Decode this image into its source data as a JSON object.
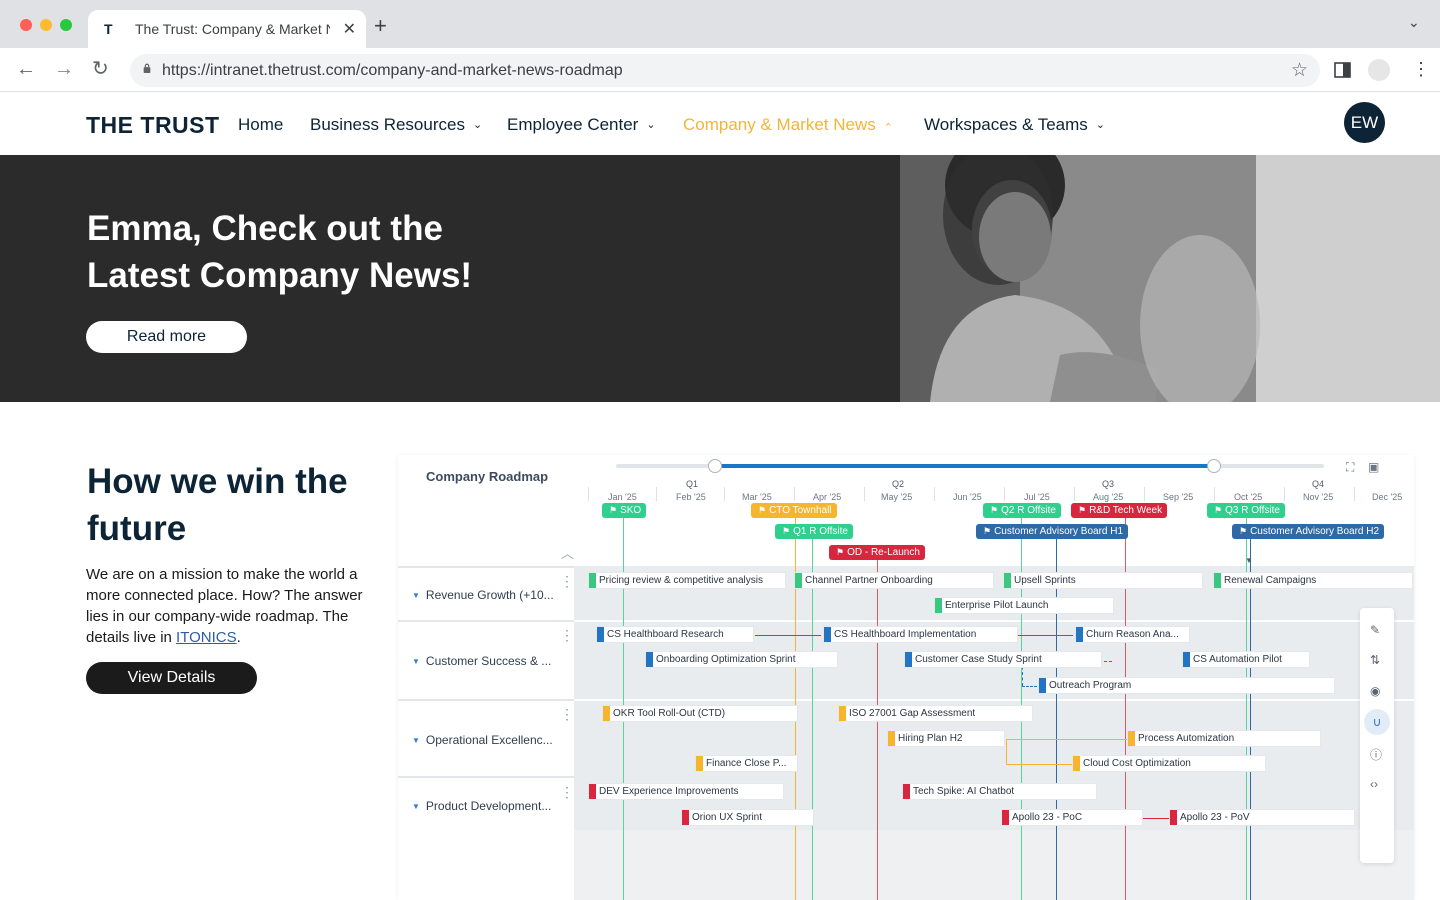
{
  "browser": {
    "tab_title": "The Trust: Company & Market News",
    "tab_favicon": "T",
    "url": "https://intranet.thetrust.com/company-and-market-news-roadmap",
    "icons": [
      "back-icon",
      "forward-icon",
      "reload-icon",
      "lock-icon",
      "star-icon",
      "sidepanel-icon",
      "profile-icon",
      "menu-icon"
    ]
  },
  "site": {
    "logo": "THE TRUST",
    "nav": [
      {
        "label": "Home",
        "active": false
      },
      {
        "label": "Business Resources",
        "active": false
      },
      {
        "label": "Employee Center",
        "active": false
      },
      {
        "label": "Company & Market News",
        "active": true
      },
      {
        "label": "Workspaces & Teams",
        "active": false
      }
    ],
    "avatar_initials": "EW",
    "accent_color": "#f2b635",
    "navy": "#0d2436"
  },
  "hero": {
    "headline": "Emma, Check out the Latest Company News!",
    "button": "Read more"
  },
  "win": {
    "heading": "How we win the future",
    "body_before_link": "We are on a mission to make the world a more connected place. How? The answer lies in our company-wide roadmap. The details live in ",
    "link_text": "ITONICS",
    "body_after_link": ".",
    "button": "View Details"
  },
  "roadmap": {
    "title": "Company Roadmap",
    "quarters": [
      "Q1",
      "Q2",
      "Q3",
      "Q4"
    ],
    "months": [
      "Jan '25",
      "Feb '25",
      "Mar '25",
      "Apr '25",
      "May '25",
      "Jun '25",
      "Jul '25",
      "Aug '25",
      "Sep '25",
      "Oct '25",
      "Nov '25",
      "Dec '25"
    ],
    "milestones": [
      {
        "label": "SKO",
        "color": "#2fcf8e"
      },
      {
        "label": "CTO Townhall",
        "color": "#f6b52c"
      },
      {
        "label": "Q1 R Offsite",
        "color": "#2fcf8e"
      },
      {
        "label": "OD - Re-Launch",
        "color": "#d7263d"
      },
      {
        "label": "Q2 R Offsite",
        "color": "#2fcf8e"
      },
      {
        "label": "R&D Tech Week",
        "color": "#d7263d"
      },
      {
        "label": "Q3 R Offsite",
        "color": "#2fcf8e"
      },
      {
        "label": "Customer Advisory Board H1",
        "color": "#2e6aa6"
      },
      {
        "label": "Customer Advisory Board H2",
        "color": "#2e6aa6"
      }
    ],
    "lanes": [
      {
        "label": "Revenue Growth (+10...",
        "color": "#3ac77f",
        "items": [
          "Pricing review & competitive analysis",
          "Channel Partner Onboarding",
          "Upsell Sprints",
          "Renewal Campaigns",
          "Enterprise Pilot Launch"
        ]
      },
      {
        "label": "Customer Success & ...",
        "color": "#2474c4",
        "items": [
          "CS Healthboard Research",
          "CS Healthboard Implementation",
          "Churn Reason Ana...",
          "Onboarding Optimization Sprint",
          "Customer Case Study Sprint",
          "CS Automation Pilot",
          "Outreach Program"
        ]
      },
      {
        "label": "Operational Excellenc...",
        "color": "#f6b52c",
        "items": [
          "OKR Tool Roll-Out (CTD)",
          "ISO 27001 Gap Assessment",
          "Hiring Plan H2",
          "Process Automization",
          "Finance Close P...",
          "Cloud Cost Optimization"
        ]
      },
      {
        "label": "Product Development...",
        "color": "#d7263d",
        "items": [
          "DEV Experience Improvements",
          "Tech Spike: AI Chatbot",
          "Orion UX Sprint",
          "Apollo 23 - PoC",
          "Apollo 23 - PoV"
        ]
      }
    ],
    "tools": [
      "pencil-icon",
      "sort-icon",
      "eye-icon",
      "magnet-icon",
      "info-icon",
      "code-icon"
    ]
  }
}
